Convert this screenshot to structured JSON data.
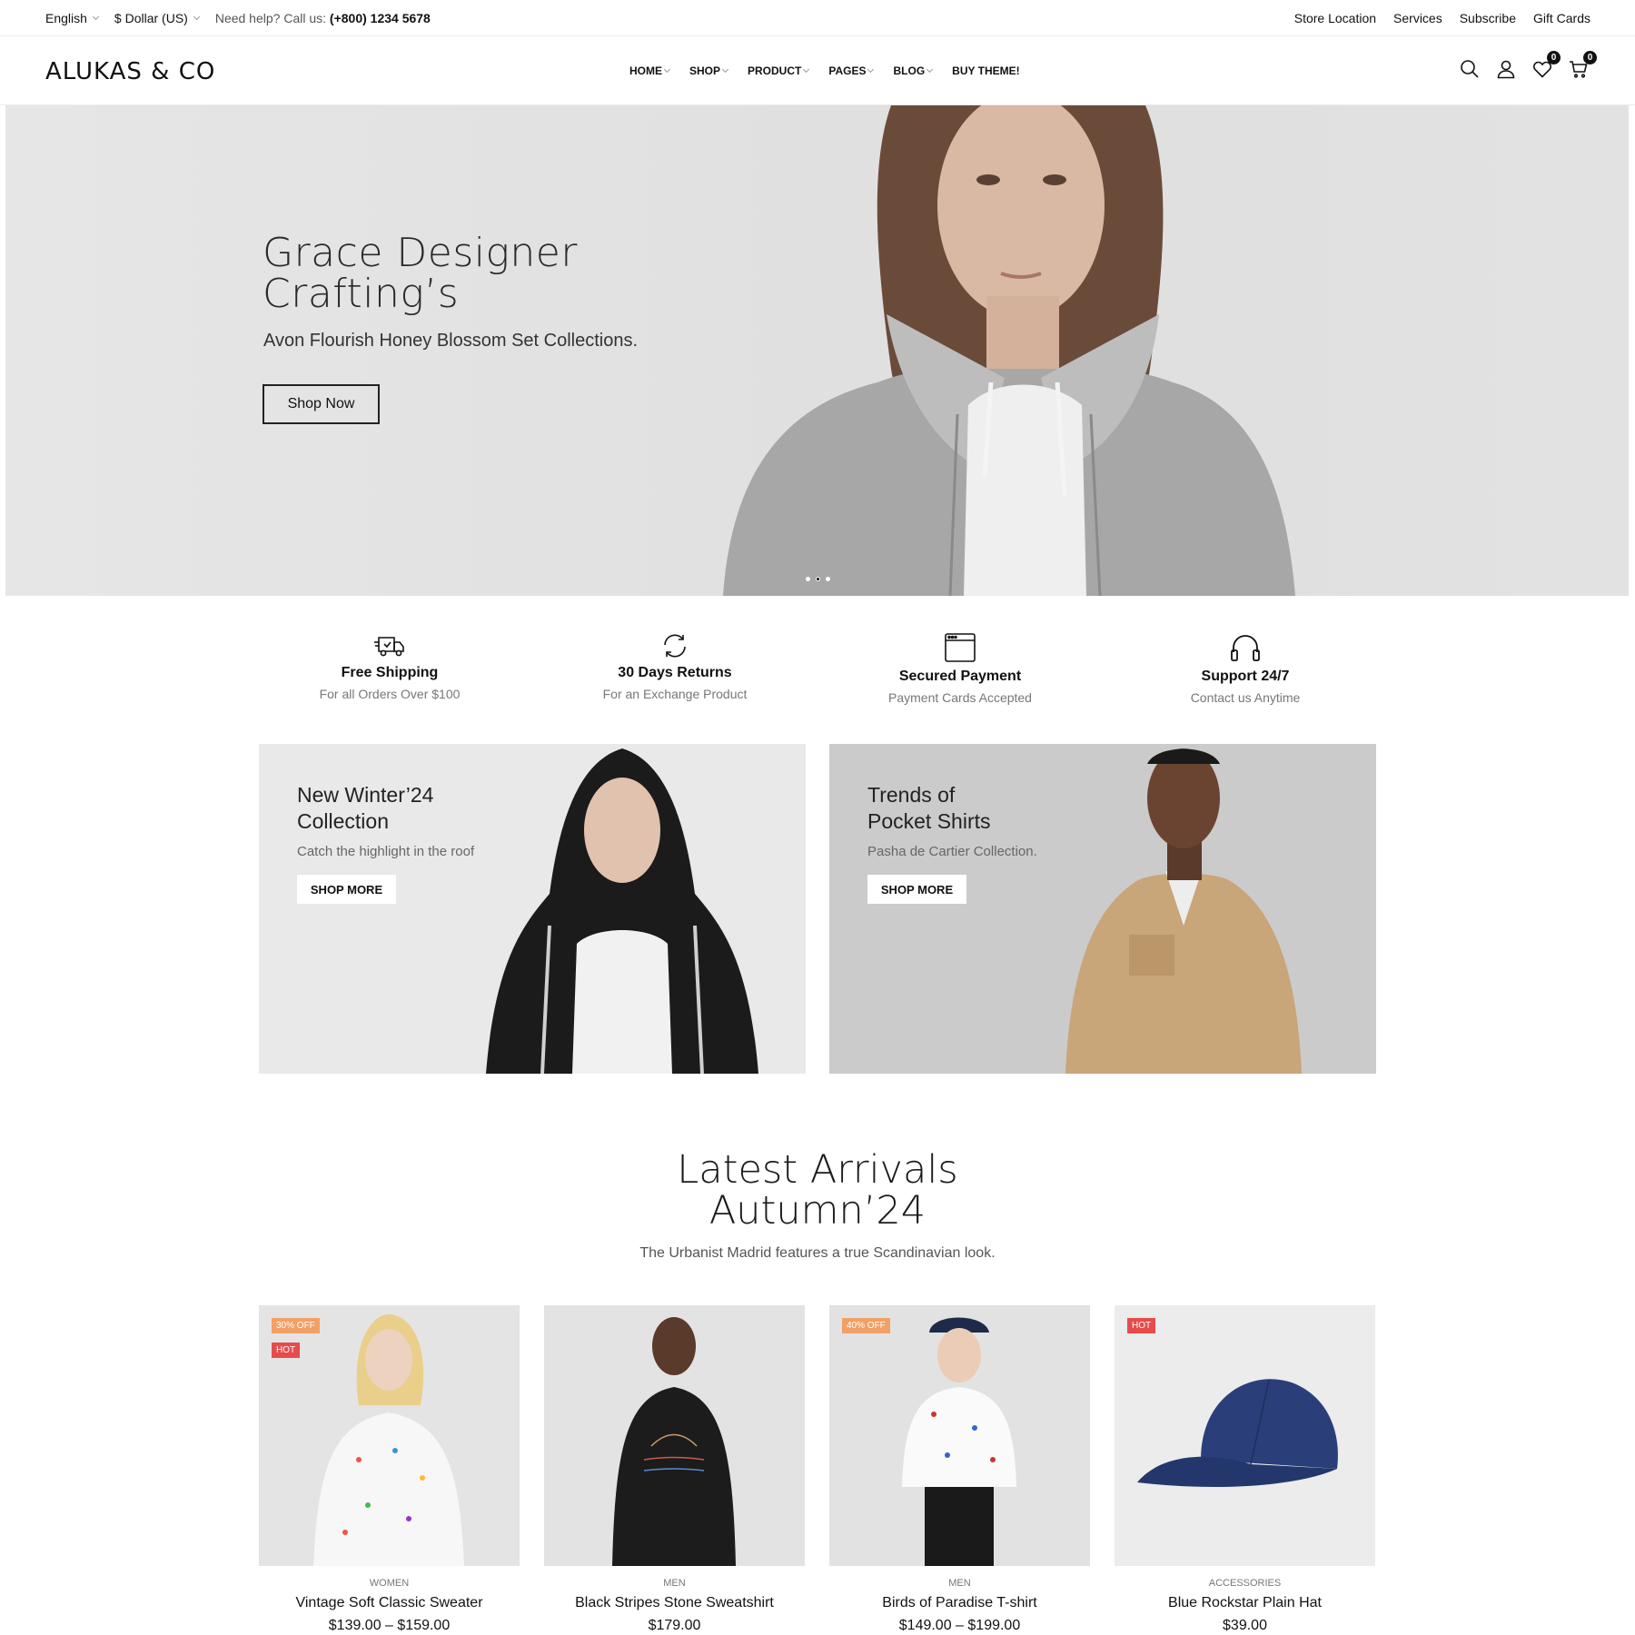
{
  "topbar": {
    "language": "English",
    "currency": "$ Dollar (US)",
    "help_text": "Need help? Call us:",
    "phone": "(+800) 1234 5678",
    "links": [
      "Store Location",
      "Services",
      "Subscribe",
      "Gift Cards"
    ]
  },
  "header": {
    "logo": "ALUKAS & CO",
    "nav": [
      "HOME",
      "SHOP",
      "PRODUCT",
      "PAGES",
      "BLOG",
      "BUY THEME!"
    ],
    "wishlist_count": "0",
    "cart_count": "0"
  },
  "hero": {
    "title_line1": "Grace Designer",
    "title_line2": "Crafting’s",
    "subtitle": "Avon Flourish Honey Blossom Set Collections.",
    "button": "Shop Now"
  },
  "features": [
    {
      "title": "Free Shipping",
      "sub": "For all Orders Over $100",
      "icon": "truck-icon"
    },
    {
      "title": "30 Days Returns",
      "sub": "For an Exchange Product",
      "icon": "return-icon"
    },
    {
      "title": "Secured Payment",
      "sub": "Payment Cards Accepted",
      "icon": "payment-window-icon"
    },
    {
      "title": "Support 24/7",
      "sub": "Contact us Anytime",
      "icon": "headphones-icon"
    }
  ],
  "banners": [
    {
      "title_line1": "New Winter’24",
      "title_line2": "Collection",
      "sub": "Catch the highlight in the roof",
      "button": "SHOP MORE"
    },
    {
      "title_line1": "Trends of",
      "title_line2": "Pocket Shirts",
      "sub": "Pasha de Cartier Collection.",
      "button": "SHOP MORE"
    }
  ],
  "latest": {
    "title_line1": "Latest Arrivals",
    "title_line2": "Autumn’24",
    "subtitle": "The Urbanist Madrid features a true Scandinavian look."
  },
  "products": [
    {
      "category": "WOMEN",
      "name": "Vintage Soft Classic Sweater",
      "price": "$139.00 – $159.00",
      "badges": [
        "30% OFF",
        "HOT"
      ]
    },
    {
      "category": "MEN",
      "name": "Black Stripes Stone Sweatshirt",
      "price": "$179.00",
      "badges": []
    },
    {
      "category": "MEN",
      "name": "Birds of Paradise T-shirt",
      "price": "$149.00 – $199.00",
      "badges": [
        "40% OFF"
      ]
    },
    {
      "category": "ACCESSORIES",
      "name": "Blue Rockstar Plain Hat",
      "price": "$39.00",
      "badges": [
        "HOT"
      ]
    }
  ],
  "colors": {
    "sale_badge": "#f2a065",
    "hot_badge": "#e74c4c",
    "text": "#111111"
  }
}
